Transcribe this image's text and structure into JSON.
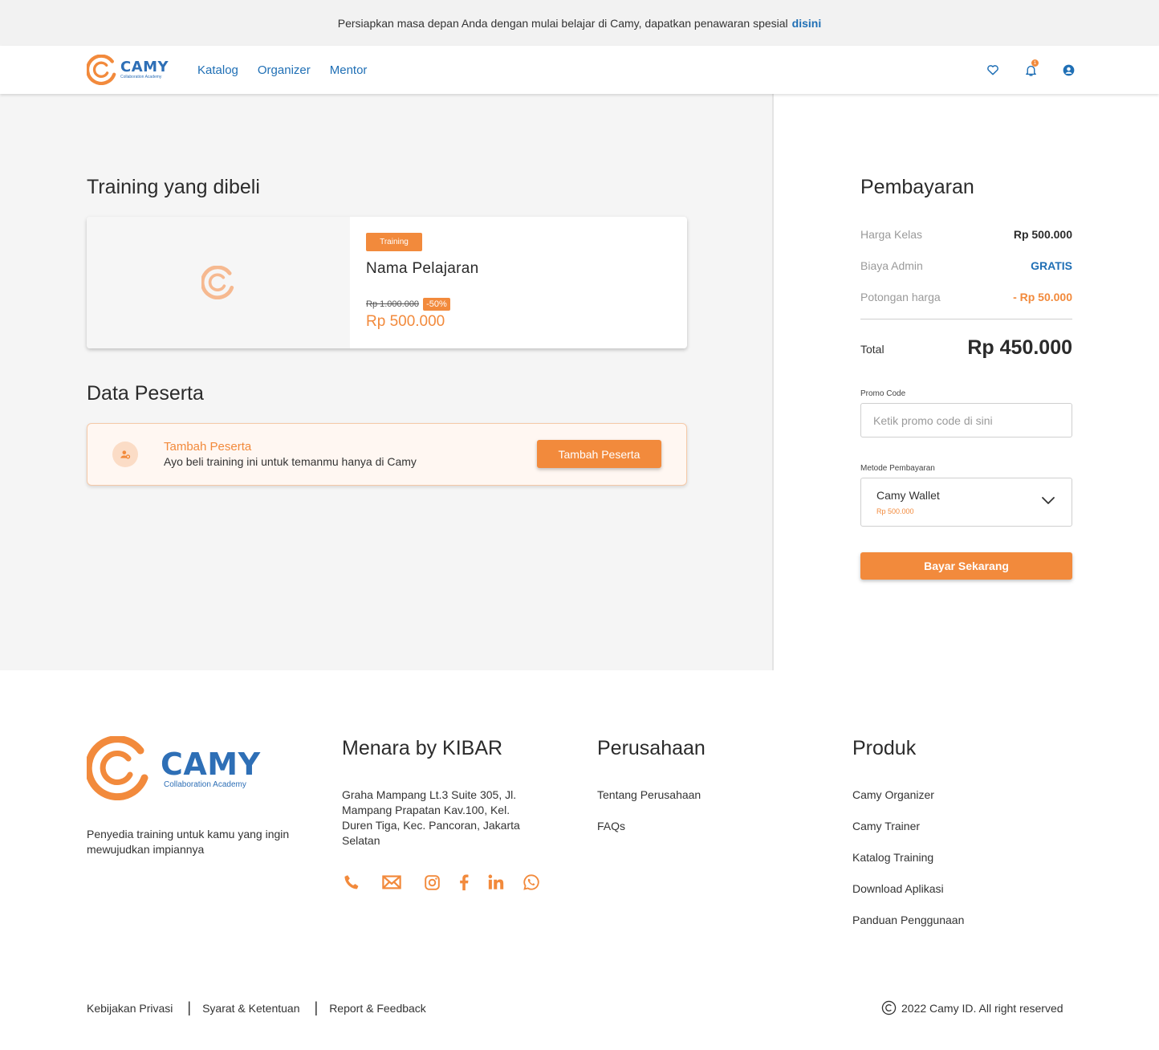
{
  "announcement": {
    "text": "Persiapkan masa depan Anda dengan mulai belajar di Camy, dapatkan penawaran spesial",
    "link": "disini"
  },
  "brand": {
    "name": "CAMY",
    "subtitle": "Collaboration Academy",
    "primary_color": "#f28a3c",
    "secondary_color": "#2e6fb6"
  },
  "nav": {
    "links": [
      "Katalog",
      "Organizer",
      "Mentor"
    ],
    "icons": [
      "heart-icon",
      "bell-icon",
      "user-icon"
    ],
    "notification_count": "1"
  },
  "purchase": {
    "title": "Training yang dibeli",
    "course": {
      "tag": "Training",
      "name": "Nama Pelajaran",
      "old_price": "Rp 1.000.000",
      "discount": "-50%",
      "price": "Rp 500.000"
    }
  },
  "participants": {
    "title": "Data Peserta",
    "card_title": "Tambah Peserta",
    "card_desc": "Ayo beli training ini untuk temanmu hanya di Camy",
    "button": "Tambah Peserta"
  },
  "payment": {
    "title": "Pembayaran",
    "rows": [
      {
        "label": "Harga Kelas",
        "value": "Rp 500.000",
        "color": "#2b2b2b"
      },
      {
        "label": "Biaya Admin",
        "value": "GRATIS",
        "color": "#1f6fb5"
      },
      {
        "label": "Potongan harga",
        "value": "- Rp 50.000",
        "color": "#f28a3c"
      }
    ],
    "total_label": "Total",
    "total_value": "Rp 450.000",
    "promo_label": "Promo Code",
    "promo_placeholder": "Ketik promo code di sini",
    "method_label": "Metode Pembayaran",
    "method_name": "Camy Wallet",
    "method_balance": "Rp 500.000",
    "pay_button": "Bayar Sekarang"
  },
  "footer": {
    "tagline": "Penyedia training untuk kamu yang ingin mewujudkan impiannya",
    "address_title": "Menara by KIBAR",
    "address": "Graha Mampang Lt.3 Suite 305, Jl. Mampang Prapatan Kav.100, Kel. Duren Tiga, Kec. Pancoran, Jakarta Selatan",
    "social_icons": [
      "phone-icon",
      "mail-icon",
      "instagram-icon",
      "facebook-icon",
      "linkedin-icon",
      "whatsapp-icon"
    ],
    "company_title": "Perusahaan",
    "company_links": [
      "Tentang Perusahaan",
      "FAQs"
    ],
    "product_title": "Produk",
    "product_links": [
      "Camy Organizer",
      "Camy Trainer",
      "Katalog Training",
      "Download Aplikasi",
      "Panduan Penggunaan"
    ],
    "bottom_links": [
      "Kebijakan Privasi",
      "Syarat & Ketentuan",
      "Report & Feedback"
    ],
    "copyright": "2022 Camy ID. All right reserved"
  }
}
